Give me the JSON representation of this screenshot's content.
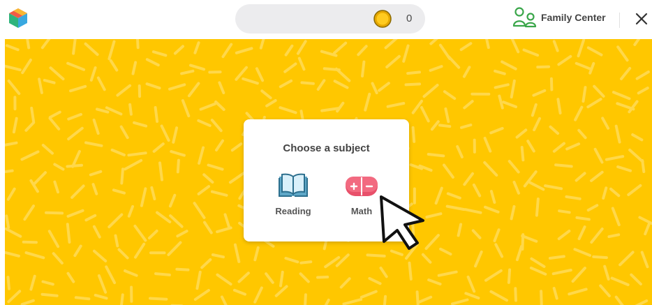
{
  "topbar": {
    "logo_icon": "cube-logo-icon",
    "coins": {
      "icon": "coin-icon",
      "count": "0"
    },
    "family_center": {
      "icon": "parents-icon",
      "label": "Family Center"
    },
    "close_icon": "close-icon"
  },
  "stage": {
    "background_color": "#ffc700",
    "pattern_color": "#ffd84a"
  },
  "subject_card": {
    "title": "Choose a subject",
    "subjects": [
      {
        "label": "Reading",
        "icon": "book-icon",
        "color": "#5fa8c8"
      },
      {
        "label": "Math",
        "icon": "plus-minus-icon",
        "color": "#e8506a"
      }
    ]
  },
  "cursor_icon": "pointer-cursor-icon"
}
